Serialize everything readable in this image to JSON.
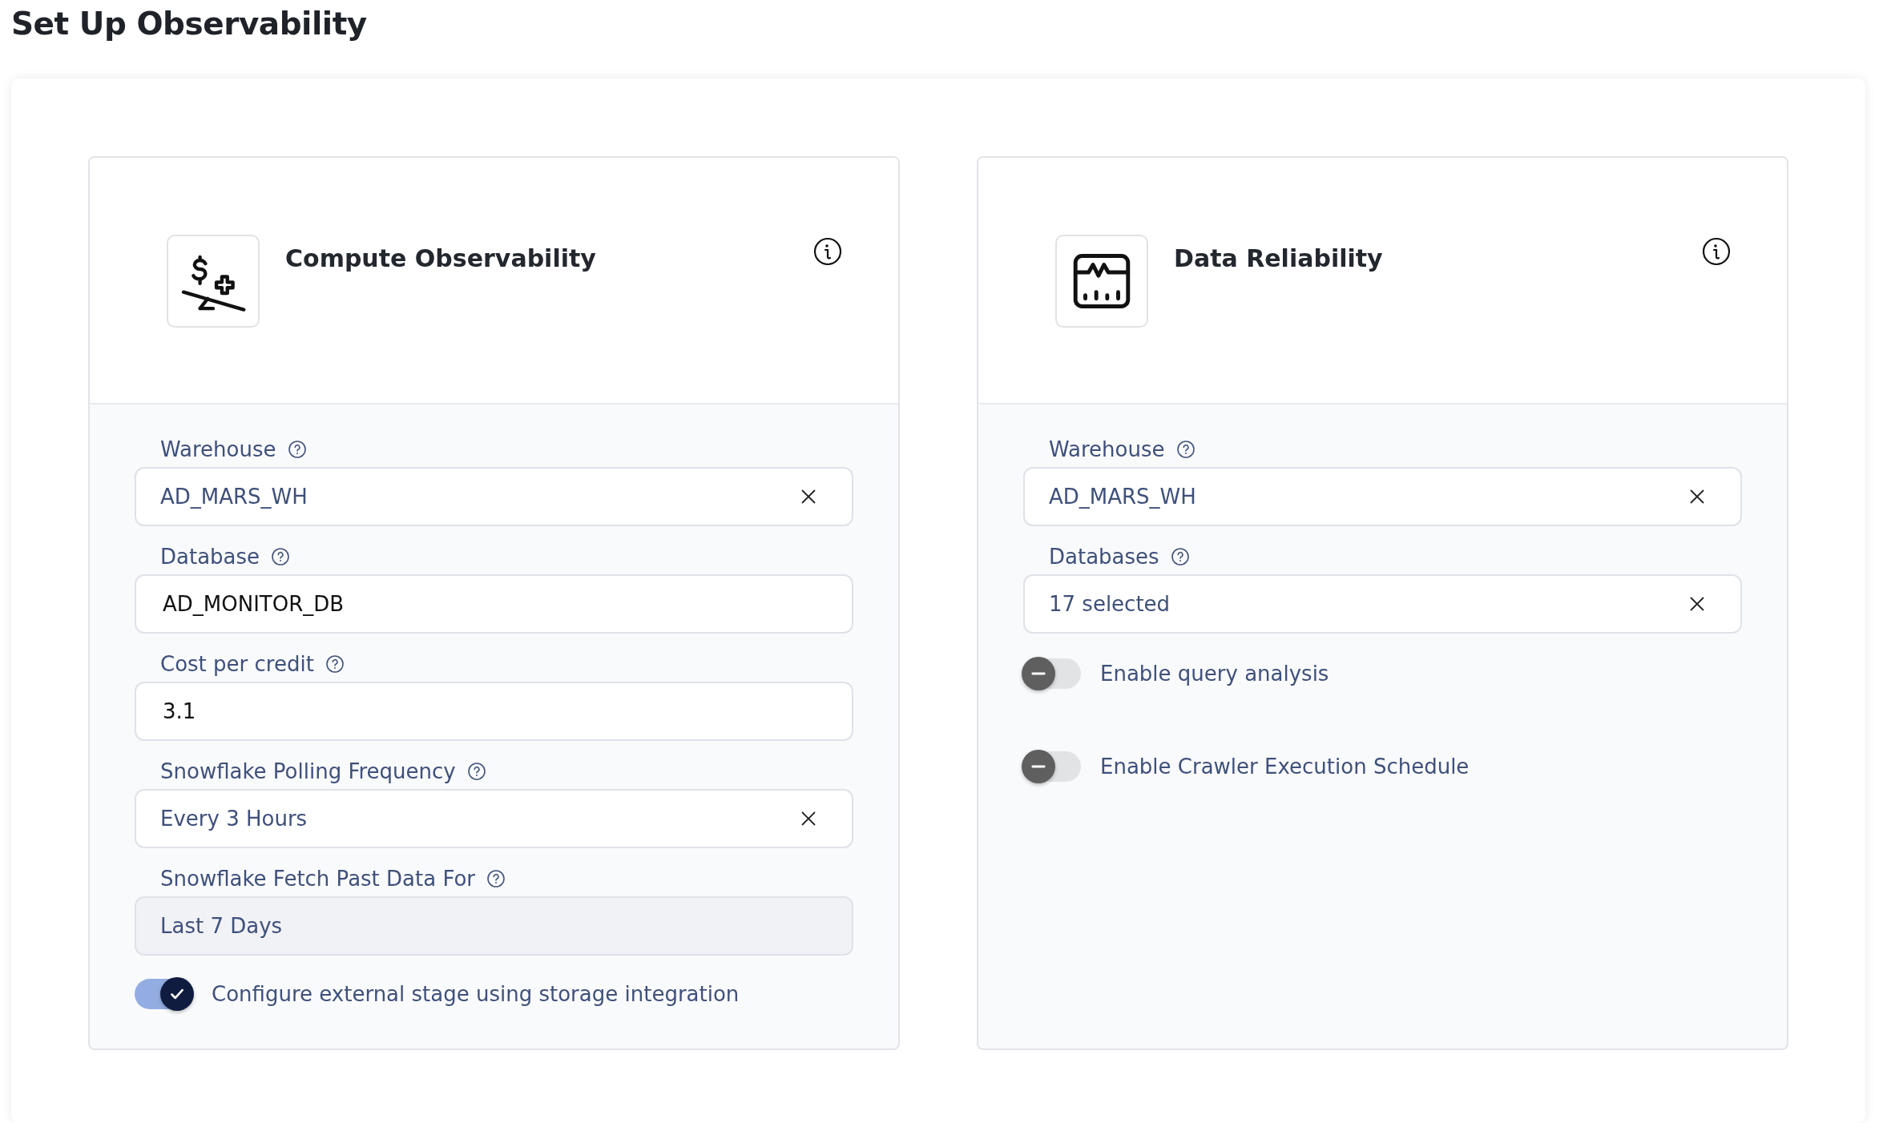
{
  "page_title": "Set Up Observability",
  "cards": [
    {
      "title": "Compute Observability",
      "fields": [
        {
          "label": "Warehouse",
          "kind": "select",
          "value": "AD_MARS_WH",
          "clearable": true,
          "disabled": false
        },
        {
          "label": "Database",
          "kind": "text",
          "value": "AD_MONITOR_DB",
          "clearable": false,
          "disabled": false
        },
        {
          "label": "Cost per credit",
          "kind": "text",
          "value": "3.1",
          "clearable": false,
          "disabled": false
        },
        {
          "label": "Snowflake Polling Frequency",
          "kind": "select",
          "value": "Every 3 Hours",
          "clearable": true,
          "disabled": false
        },
        {
          "label": "Snowflake Fetch Past Data For",
          "kind": "select",
          "value": "Last 7 Days",
          "clearable": false,
          "disabled": true
        }
      ],
      "toggles": [
        {
          "label": "Configure external stage using storage integration",
          "on": true
        }
      ]
    },
    {
      "title": "Data Reliability",
      "fields": [
        {
          "label": "Warehouse",
          "kind": "select",
          "value": "AD_MARS_WH",
          "clearable": true,
          "disabled": false
        },
        {
          "label": "Databases",
          "kind": "select",
          "value": "17 selected",
          "clearable": true,
          "disabled": false
        }
      ],
      "toggles": [
        {
          "label": "Enable query analysis",
          "on": false
        },
        {
          "label": "Enable Crawler Execution Schedule",
          "on": false
        }
      ]
    }
  ]
}
